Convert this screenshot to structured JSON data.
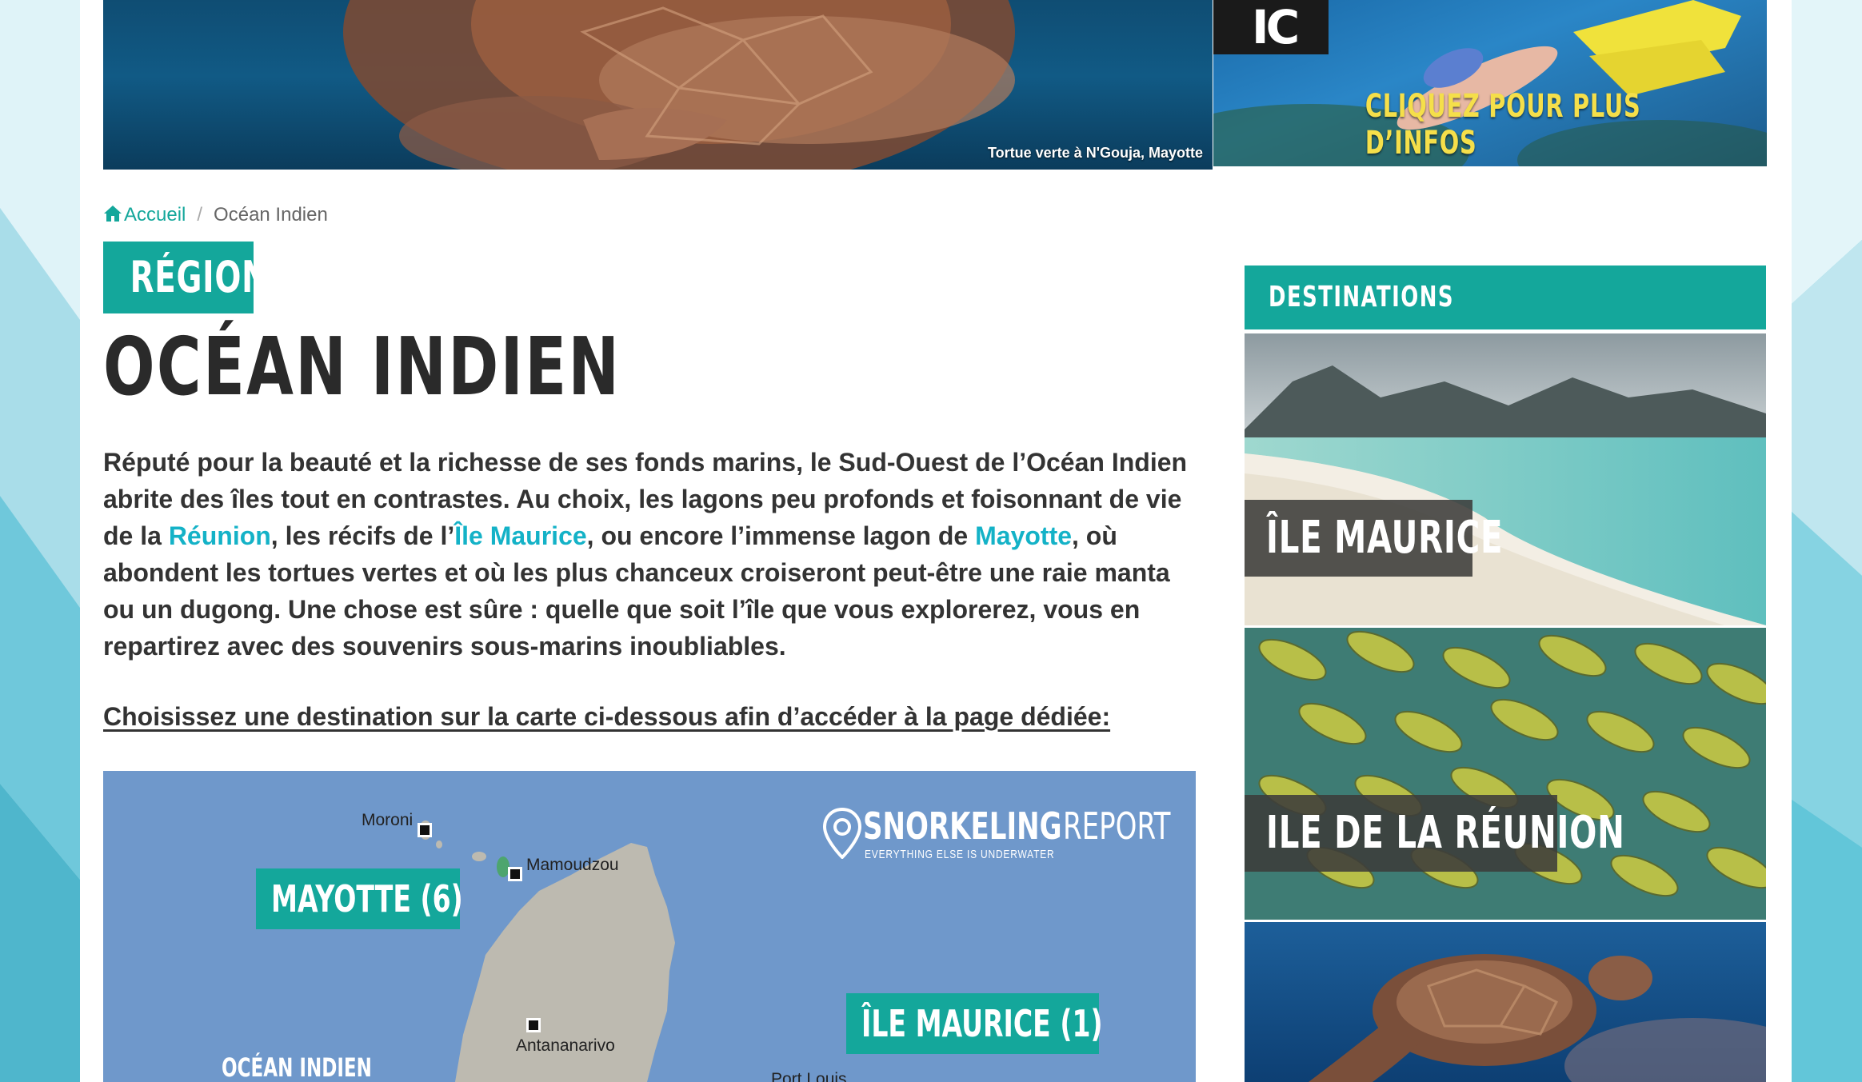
{
  "hero": {
    "caption": "Tortue verte à N'Gouja, Mayotte"
  },
  "ad": {
    "logo_text": "IC",
    "cta": "CLIQUEZ POUR PLUS D’INFOS"
  },
  "breadcrumb": {
    "home": "Accueil",
    "separator": "/",
    "current": "Océan Indien"
  },
  "header": {
    "badge": "RÉGION",
    "title": "OCÉAN INDIEN"
  },
  "intro": {
    "p1": "Réputé pour la beauté et la richesse de ses fonds marins, le Sud-Ouest de l’Océan Indien abrite des îles tout en contrastes. Au choix, les lagons peu profonds et foisonnant de vie de la ",
    "link_reunion": "Réunion",
    "p2": ", les récifs de l’",
    "link_maurice": "Île Maurice",
    "p3": ", ou encore l’immense lagon de ",
    "link_mayotte": "Mayotte",
    "p4": ", où abondent les tortues vertes et où les plus chanceux croiseront peut-être une raie manta ou un dugong. Une chose est sûre : quelle que soit l’île que vous explorerez, vous en repartirez avec des souvenirs sous-marins inoubliables."
  },
  "cta_line": "Choisissez une destination sur la carte ci-dessous afin d’accéder à la page dédiée:",
  "map": {
    "labels": {
      "mayotte": "MAYOTTE (6)",
      "maurice": "ÎLE MAURICE (1)"
    },
    "cities": {
      "moroni": "Moroni",
      "mamoudzou": "Mamoudzou",
      "antananarivo": "Antananarivo",
      "port_louis": "Port Louis"
    },
    "ocean": "OCÉAN INDIEN",
    "brand": {
      "name1": "SNORKELING",
      "name2": "REPORT",
      "tagline": "EVERYTHING ELSE IS UNDERWATER"
    }
  },
  "sidebar": {
    "title": "DESTINATIONS",
    "items": [
      {
        "label": "ÎLE MAURICE"
      },
      {
        "label": "ILE DE LA RÉUNION"
      },
      {
        "label": ""
      }
    ]
  },
  "colors": {
    "accent": "#14a79b",
    "link": "#14b2c7",
    "text": "#333333"
  },
  "icons": [
    "home-icon",
    "map-pin-icon"
  ]
}
